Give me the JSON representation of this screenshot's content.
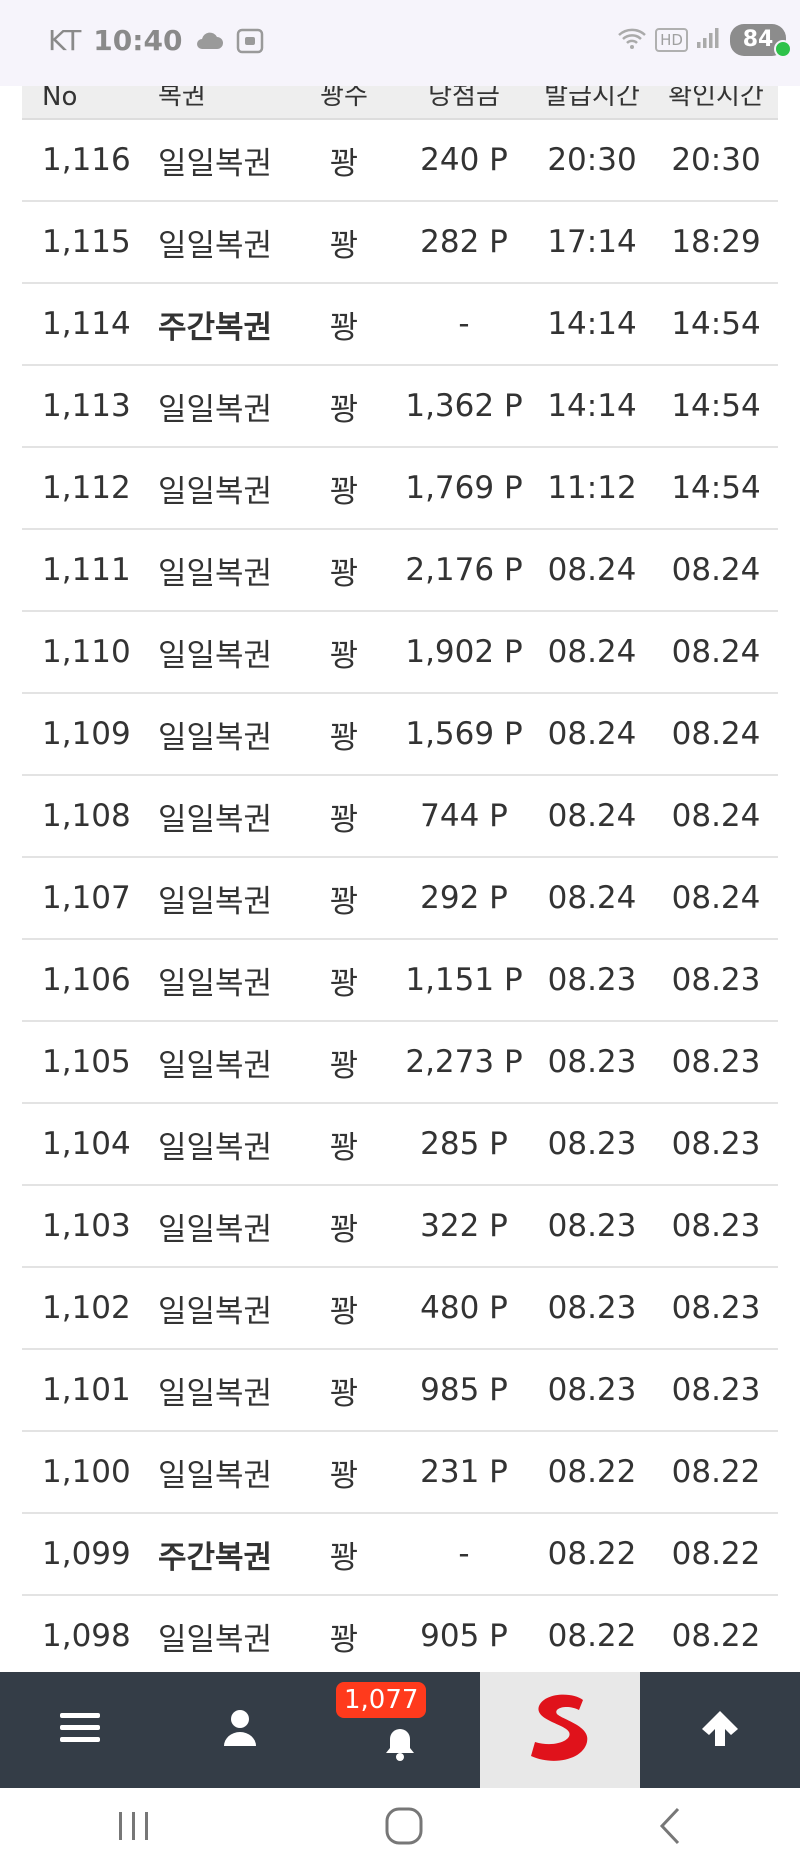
{
  "status_bar": {
    "carrier": "KT",
    "time": "10:40",
    "battery": "84",
    "hd": "HD"
  },
  "table": {
    "headers": [
      "No",
      "복권",
      "꽝수",
      "당첨금",
      "발급시간",
      "확인시간"
    ],
    "rows": [
      {
        "no": "1,116",
        "type": "일일복권",
        "result": "꽝",
        "points": "240 P",
        "time": "20:30",
        "confirm": "20:30",
        "bold": false
      },
      {
        "no": "1,115",
        "type": "일일복권",
        "result": "꽝",
        "points": "282 P",
        "time": "17:14",
        "confirm": "18:29",
        "bold": false
      },
      {
        "no": "1,114",
        "type": "주간복권",
        "result": "꽝",
        "points": "-",
        "time": "14:14",
        "confirm": "14:54",
        "bold": true
      },
      {
        "no": "1,113",
        "type": "일일복권",
        "result": "꽝",
        "points": "1,362 P",
        "time": "14:14",
        "confirm": "14:54",
        "bold": false
      },
      {
        "no": "1,112",
        "type": "일일복권",
        "result": "꽝",
        "points": "1,769 P",
        "time": "11:12",
        "confirm": "14:54",
        "bold": false
      },
      {
        "no": "1,111",
        "type": "일일복권",
        "result": "꽝",
        "points": "2,176 P",
        "time": "08.24",
        "confirm": "08.24",
        "bold": false
      },
      {
        "no": "1,110",
        "type": "일일복권",
        "result": "꽝",
        "points": "1,902 P",
        "time": "08.24",
        "confirm": "08.24",
        "bold": false
      },
      {
        "no": "1,109",
        "type": "일일복권",
        "result": "꽝",
        "points": "1,569 P",
        "time": "08.24",
        "confirm": "08.24",
        "bold": false
      },
      {
        "no": "1,108",
        "type": "일일복권",
        "result": "꽝",
        "points": "744 P",
        "time": "08.24",
        "confirm": "08.24",
        "bold": false
      },
      {
        "no": "1,107",
        "type": "일일복권",
        "result": "꽝",
        "points": "292 P",
        "time": "08.24",
        "confirm": "08.24",
        "bold": false
      },
      {
        "no": "1,106",
        "type": "일일복권",
        "result": "꽝",
        "points": "1,151 P",
        "time": "08.23",
        "confirm": "08.23",
        "bold": false
      },
      {
        "no": "1,105",
        "type": "일일복권",
        "result": "꽝",
        "points": "2,273 P",
        "time": "08.23",
        "confirm": "08.23",
        "bold": false
      },
      {
        "no": "1,104",
        "type": "일일복권",
        "result": "꽝",
        "points": "285 P",
        "time": "08.23",
        "confirm": "08.23",
        "bold": false
      },
      {
        "no": "1,103",
        "type": "일일복권",
        "result": "꽝",
        "points": "322 P",
        "time": "08.23",
        "confirm": "08.23",
        "bold": false
      },
      {
        "no": "1,102",
        "type": "일일복권",
        "result": "꽝",
        "points": "480 P",
        "time": "08.23",
        "confirm": "08.23",
        "bold": false
      },
      {
        "no": "1,101",
        "type": "일일복권",
        "result": "꽝",
        "points": "985 P",
        "time": "08.23",
        "confirm": "08.23",
        "bold": false
      },
      {
        "no": "1,100",
        "type": "일일복권",
        "result": "꽝",
        "points": "231 P",
        "time": "08.22",
        "confirm": "08.22",
        "bold": false
      },
      {
        "no": "1,099",
        "type": "주간복권",
        "result": "꽝",
        "points": "-",
        "time": "08.22",
        "confirm": "08.22",
        "bold": true
      },
      {
        "no": "1,098",
        "type": "일일복권",
        "result": "꽝",
        "points": "905 P",
        "time": "08.22",
        "confirm": "08.22",
        "bold": false
      }
    ]
  },
  "bottom_nav": {
    "items": [
      {
        "icon": "menu-icon"
      },
      {
        "icon": "user-icon"
      },
      {
        "icon": "bell-icon",
        "badge": "1,077"
      },
      {
        "icon": "site-logo"
      },
      {
        "icon": "arrow-up-icon"
      }
    ]
  },
  "colors": {
    "nav_bg": "#343d47",
    "badge": "#ff3a1c",
    "logo_red": "#e0121b",
    "header_bg": "#eeeeee"
  }
}
